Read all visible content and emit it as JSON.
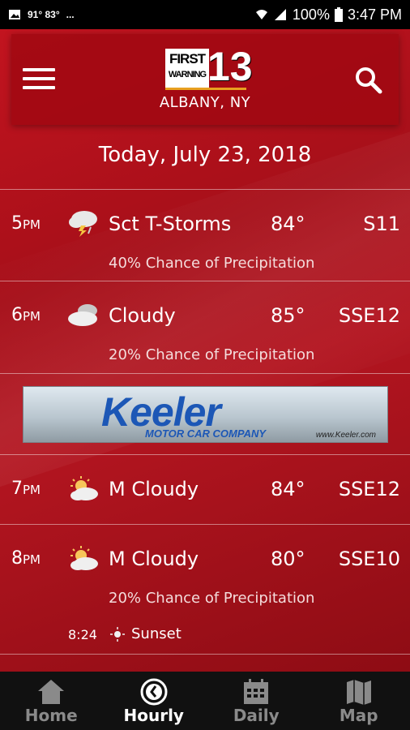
{
  "status_bar": {
    "temps": "91° 83°",
    "more": "...",
    "battery": "100%",
    "time": "3:47 PM"
  },
  "header": {
    "logo_line1": "FIRST",
    "logo_line2": "WARNING",
    "logo_number": "13",
    "location": "ALBANY, NY"
  },
  "date_title": "Today, July 23, 2018",
  "hours": [
    {
      "hour": "5",
      "ampm": "PM",
      "icon": "thunderstorm-icon",
      "condition": "Sct T-Storms",
      "temp": "84°",
      "wind": "S11",
      "precip": "40% Chance of Precipitation"
    },
    {
      "hour": "6",
      "ampm": "PM",
      "icon": "cloudy-icon",
      "condition": "Cloudy",
      "temp": "85°",
      "wind": "SSE12",
      "precip": "20% Chance of Precipitation"
    },
    {
      "hour": "7",
      "ampm": "PM",
      "icon": "partly-cloudy-icon",
      "condition": "M Cloudy",
      "temp": "84°",
      "wind": "SSE12",
      "precip": ""
    },
    {
      "hour": "8",
      "ampm": "PM",
      "icon": "partly-cloudy-icon",
      "condition": "M Cloudy",
      "temp": "80°",
      "wind": "SSE10",
      "precip": "20% Chance of Precipitation"
    }
  ],
  "sunset": {
    "time": "8:24",
    "label": "Sunset"
  },
  "ad": {
    "brand": "Keeler",
    "subtitle": "MOTOR CAR COMPANY",
    "url": "www.Keeler.com"
  },
  "nav": [
    {
      "label": "Home",
      "icon": "home-icon",
      "active": false
    },
    {
      "label": "Hourly",
      "icon": "clock-icon",
      "active": true
    },
    {
      "label": "Daily",
      "icon": "calendar-icon",
      "active": false
    },
    {
      "label": "Map",
      "icon": "map-icon",
      "active": false
    }
  ],
  "colors": {
    "background_red": "#b3141e",
    "header_red": "#a00812",
    "ad_blue": "#1c57b6",
    "nav_bg": "#111111"
  }
}
